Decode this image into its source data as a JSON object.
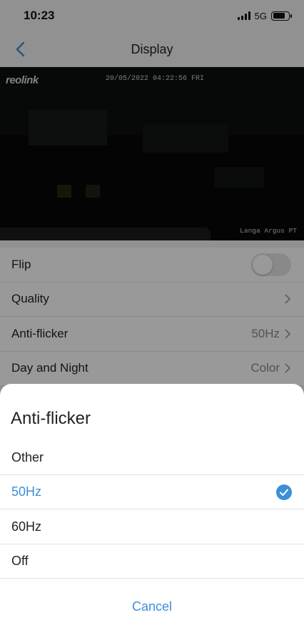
{
  "status_bar": {
    "time": "10:23",
    "network": "5G",
    "battery_level": 0.78
  },
  "nav": {
    "title": "Display",
    "back_icon": "chevron-left-icon"
  },
  "camera": {
    "logo": "reolink",
    "timestamp": "20/05/2022 04:22:56 FRI",
    "camera_name": "Langa Argus PT"
  },
  "settings": {
    "flip_label": "Flip",
    "flip_on": false,
    "quality_label": "Quality",
    "anti_flicker_label": "Anti-flicker",
    "anti_flicker_value": "50Hz",
    "day_night_label": "Day and Night",
    "day_night_value": "Color"
  },
  "sheet": {
    "title": "Anti-flicker",
    "options": [
      {
        "label": "Other",
        "selected": false
      },
      {
        "label": "50Hz",
        "selected": true
      },
      {
        "label": "60Hz",
        "selected": false
      },
      {
        "label": "Off",
        "selected": false
      }
    ],
    "cancel_label": "Cancel"
  },
  "colors": {
    "accent": "#3d8fd8",
    "overlay": "rgba(0,0,0,0.4)"
  }
}
